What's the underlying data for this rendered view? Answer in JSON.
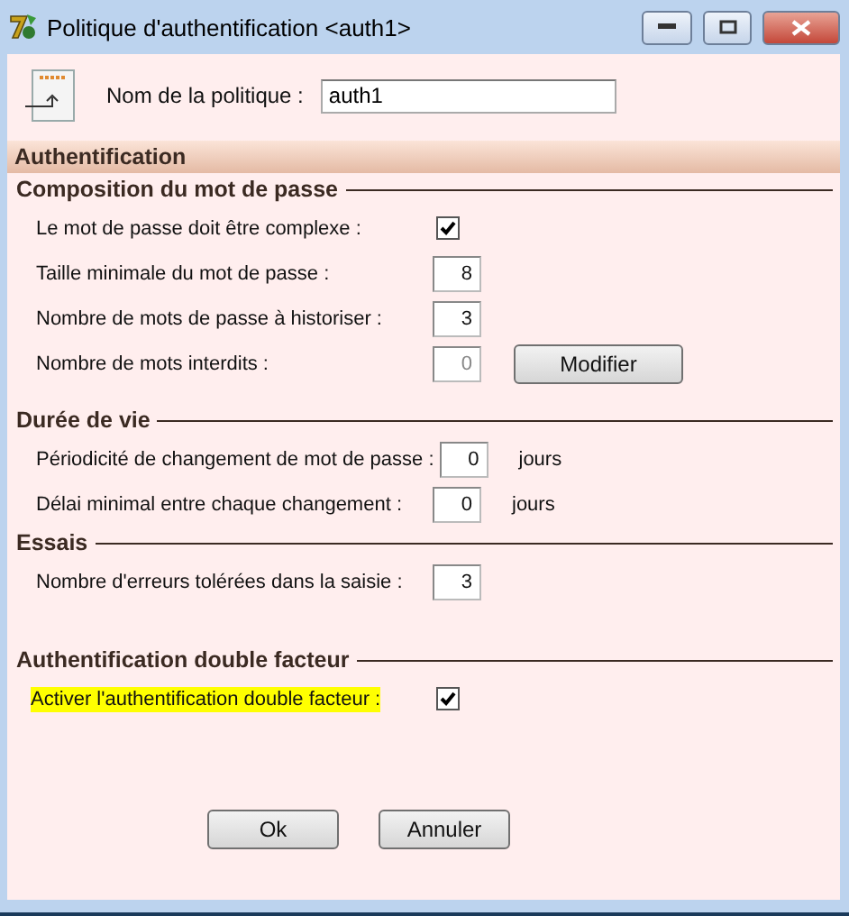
{
  "window": {
    "title": "Politique d'authentification <auth1>"
  },
  "policy_name": {
    "label": "Nom de la politique :",
    "value": "auth1"
  },
  "section": {
    "title": "Authentification"
  },
  "groups": [
    {
      "title": "Composition du mot de passe",
      "rows": [
        {
          "kind": "checkbox",
          "label": "Le mot de passe doit être complexe :",
          "checked": true,
          "highlighted": false
        },
        {
          "kind": "number",
          "label": "Taille minimale du mot de passe :",
          "value": "8",
          "disabled": false
        },
        {
          "kind": "number",
          "label": "Nombre de mots de passe à historiser :",
          "value": "3",
          "disabled": false
        },
        {
          "kind": "number",
          "label": "Nombre de mots interdits :",
          "value": "0",
          "disabled": true,
          "button": "Modifier"
        }
      ]
    },
    {
      "title": "Durée de vie",
      "rows": [
        {
          "kind": "number",
          "label": "Périodicité de changement de mot de passe :",
          "value": "0",
          "disabled": false,
          "unit": "jours"
        },
        {
          "kind": "number",
          "label": "Délai minimal entre chaque changement :",
          "value": "0",
          "disabled": false,
          "unit": "jours"
        }
      ]
    },
    {
      "title": "Essais",
      "rows": [
        {
          "kind": "number",
          "label": "Nombre d'erreurs tolérées dans la saisie :",
          "value": "3",
          "disabled": false
        }
      ]
    },
    {
      "title": "Authentification double facteur",
      "rows": [
        {
          "kind": "checkbox",
          "label": "Activer l'authentification double facteur :",
          "checked": true,
          "highlighted": true
        }
      ]
    }
  ],
  "buttons": [
    "Ok",
    "Annuler"
  ]
}
